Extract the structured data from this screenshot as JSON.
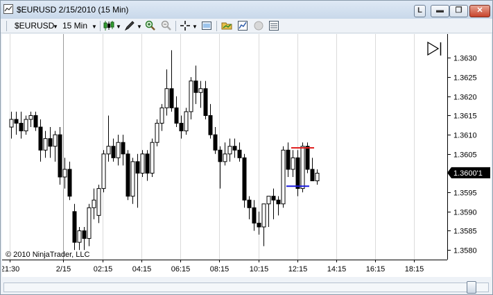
{
  "window": {
    "title": "$EURUSD  2/15/2010 (15 Min)",
    "buttons": {
      "layout": "L",
      "minimize": "▬",
      "maximize": "❐",
      "close": "✕"
    }
  },
  "toolbar": {
    "instrument": "$EURUSD",
    "interval": "15 Min",
    "icons": [
      "chart-style-icon",
      "draw-icon",
      "zoom-in-icon",
      "zoom-out-icon",
      "crosshair-icon",
      "properties-icon",
      "instruments-icon",
      "indicators-icon",
      "strategy-icon",
      "data-box-icon"
    ]
  },
  "chart": {
    "copyright": "© 2010 NinjaTrader, LLC",
    "current_price_label": "1.3600'1",
    "colors": {
      "up_candle": "#ffffff",
      "down_candle": "#000000",
      "high_line": "#e02020",
      "low_line": "#1a1adf",
      "price_marker_bg": "#000000"
    }
  },
  "chart_data": {
    "type": "candlestick",
    "y_ticks": [
      "1.3630",
      "1.3625",
      "1.3620",
      "1.3615",
      "1.3610",
      "1.3605",
      "1.3600",
      "1.3595",
      "1.3590",
      "1.3585",
      "1.3580"
    ],
    "ylim": [
      1.35775,
      1.36355
    ],
    "x_ticks": [
      "21:30",
      "2/15",
      "02:15",
      "04:15",
      "06:15",
      "08:15",
      "10:15",
      "12:15",
      "14:15",
      "16:15",
      "18:15"
    ],
    "grid": true,
    "price_axis": "right",
    "candles_ohlc": [
      [
        1.3612,
        1.3616,
        1.3609,
        1.3614
      ],
      [
        1.3614,
        1.3616,
        1.361,
        1.3613
      ],
      [
        1.3613,
        1.3616,
        1.3609,
        1.3611
      ],
      [
        1.3611,
        1.3615,
        1.361,
        1.3614
      ],
      [
        1.3614,
        1.3616,
        1.3612,
        1.3615
      ],
      [
        1.3615,
        1.3616,
        1.3611,
        1.3612
      ],
      [
        1.3612,
        1.3614,
        1.3603,
        1.3606
      ],
      [
        1.3606,
        1.3611,
        1.3604,
        1.3609
      ],
      [
        1.3609,
        1.3612,
        1.3604,
        1.3607
      ],
      [
        1.3607,
        1.3611,
        1.3603,
        1.361
      ],
      [
        1.361,
        1.3612,
        1.3597,
        1.3599
      ],
      [
        1.3599,
        1.3604,
        1.3596,
        1.3601
      ],
      [
        1.3601,
        1.3603,
        1.3593,
        1.3594
      ],
      [
        1.359,
        1.3592,
        1.358,
        1.3582
      ],
      [
        1.3582,
        1.3586,
        1.358,
        1.3585
      ],
      [
        1.3585,
        1.3586,
        1.358,
        1.3583
      ],
      [
        1.3583,
        1.3592,
        1.3581,
        1.3591
      ],
      [
        1.3591,
        1.3596,
        1.3588,
        1.3593
      ],
      [
        1.3589,
        1.3597,
        1.3587,
        1.3596
      ],
      [
        1.3596,
        1.3606,
        1.3595,
        1.3605
      ],
      [
        1.3605,
        1.3615,
        1.3603,
        1.3607
      ],
      [
        1.3607,
        1.3609,
        1.3603,
        1.3604
      ],
      [
        1.3604,
        1.361,
        1.3602,
        1.3608
      ],
      [
        1.3608,
        1.361,
        1.3602,
        1.3605
      ],
      [
        1.3605,
        1.3606,
        1.3593,
        1.3594
      ],
      [
        1.3594,
        1.3604,
        1.3592,
        1.3603
      ],
      [
        1.3603,
        1.3605,
        1.3591,
        1.36
      ],
      [
        1.36,
        1.3606,
        1.3599,
        1.3605
      ],
      [
        1.3605,
        1.3606,
        1.3598,
        1.36
      ],
      [
        1.36,
        1.3609,
        1.3599,
        1.3608
      ],
      [
        1.3608,
        1.3614,
        1.3607,
        1.3613
      ],
      [
        1.3613,
        1.3618,
        1.3611,
        1.3617
      ],
      [
        1.3617,
        1.3627,
        1.3615,
        1.3622
      ],
      [
        1.3622,
        1.3632,
        1.3616,
        1.3617
      ],
      [
        1.3617,
        1.362,
        1.3612,
        1.3613
      ],
      [
        1.3613,
        1.3615,
        1.3609,
        1.3611
      ],
      [
        1.3611,
        1.3617,
        1.361,
        1.3616
      ],
      [
        1.3616,
        1.3625,
        1.3614,
        1.3624
      ],
      [
        1.3624,
        1.3628,
        1.3618,
        1.3621
      ],
      [
        1.3621,
        1.3624,
        1.3617,
        1.3622
      ],
      [
        1.3622,
        1.3624,
        1.3614,
        1.3615
      ],
      [
        1.3615,
        1.3618,
        1.3609,
        1.361
      ],
      [
        1.361,
        1.3612,
        1.3605,
        1.3606
      ],
      [
        1.3606,
        1.3607,
        1.3596,
        1.3603
      ],
      [
        1.3603,
        1.3608,
        1.3602,
        1.3605
      ],
      [
        1.3605,
        1.3609,
        1.3603,
        1.3607
      ],
      [
        1.3607,
        1.3609,
        1.3604,
        1.3606
      ],
      [
        1.3606,
        1.3608,
        1.3603,
        1.3604
      ],
      [
        1.3604,
        1.3605,
        1.3591,
        1.3593
      ],
      [
        1.3593,
        1.3594,
        1.3588,
        1.3591
      ],
      [
        1.3591,
        1.3593,
        1.3585,
        1.3587
      ],
      [
        1.3587,
        1.359,
        1.3584,
        1.3586
      ],
      [
        1.3586,
        1.359,
        1.3581,
        1.3592
      ],
      [
        1.3592,
        1.3593,
        1.3586,
        1.3594
      ],
      [
        1.3594,
        1.3596,
        1.3588,
        1.3593
      ],
      [
        1.3593,
        1.3594,
        1.3589,
        1.3592
      ],
      [
        1.3592,
        1.3607,
        1.3591,
        1.3606
      ],
      [
        1.3606,
        1.3608,
        1.3599,
        1.3601
      ],
      [
        1.3601,
        1.3606,
        1.3599,
        1.3604
      ],
      [
        1.3604,
        1.3606,
        1.3594,
        1.3596
      ],
      [
        1.3596,
        1.3608,
        1.3595,
        1.3607
      ],
      [
        1.3607,
        1.3608,
        1.36,
        1.3601
      ],
      [
        1.3601,
        1.3604,
        1.3599,
        1.3598
      ],
      [
        1.3598,
        1.3601,
        1.3597,
        1.36
      ]
    ],
    "session_high": 1.36066,
    "session_low": 1.35966,
    "last_price": "1.3600'1"
  }
}
